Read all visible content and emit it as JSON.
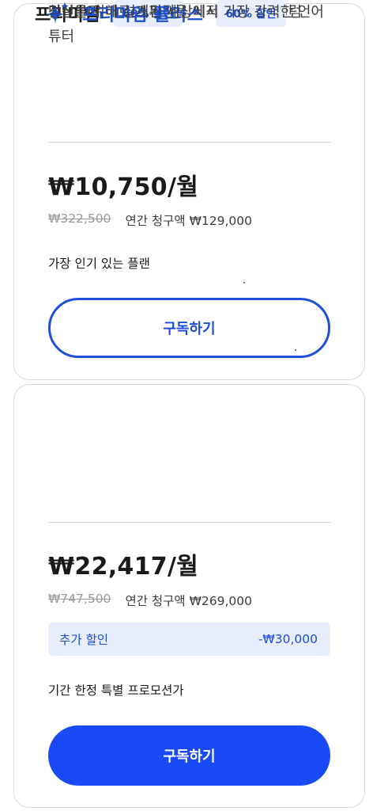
{
  "plans": [
    {
      "title": "프리미엄",
      "badge": "60% 할인",
      "description": "첫날부터 바로 스피킹을 시작하는 커리큘럼",
      "price": "₩10,750/월",
      "original_price": "₩322,500",
      "annual_billing": "연간 청구액 ₩129,000",
      "note": "가장 인기 있는 플랜",
      "button_label": "구독하기",
      "button_style": "outline"
    },
    {
      "title": "프리미엄 플러스",
      "badge": "60% 할인",
      "description": "당신을 위해 설계된 세상에서 가장 강력한 언어 튜터",
      "price": "₩22,417/월",
      "original_price": "₩747,500",
      "annual_billing": "연간 청구액 ₩269,000",
      "extra_discount": {
        "label": "추가 할인",
        "amount": "-₩30,000"
      },
      "note": "기간 한정 특별 프로모션가",
      "button_label": "구독하기",
      "button_style": "filled",
      "icon": "sparkle-icon"
    }
  ],
  "colors": {
    "accent": "#1d4fd8",
    "button_filled": "#1a4af5",
    "badge_bg": "#e8eefc",
    "border": "#d9d9d9"
  }
}
